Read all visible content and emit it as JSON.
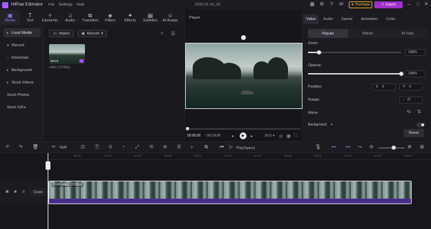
{
  "app": {
    "name": "HitPaw Edimakor",
    "menus": [
      "File",
      "Settings",
      "Help"
    ],
    "doc_title": "2025-01-15_02",
    "purchase": "Purchase",
    "export": "Export"
  },
  "tooltabs": [
    {
      "label": "Media",
      "icon": "media-icon"
    },
    {
      "label": "Text",
      "icon": "text-icon"
    },
    {
      "label": "Elements",
      "icon": "elements-icon"
    },
    {
      "label": "Audio",
      "icon": "audio-icon"
    },
    {
      "label": "Transition",
      "icon": "transition-icon"
    },
    {
      "label": "Filters",
      "icon": "filters-icon"
    },
    {
      "label": "Effects",
      "icon": "effects-icon"
    },
    {
      "label": "Subtitles",
      "icon": "subtitles-icon"
    },
    {
      "label": "AI Avatar",
      "icon": "ai-avatar-icon"
    }
  ],
  "sidebar": [
    "Local Media",
    "Record",
    "Download",
    "Background",
    "Stock Videos",
    "Stock Photos",
    "Stock GIFs"
  ],
  "media": {
    "import": "Import",
    "record": "Record",
    "thumb_duration": "00:24",
    "thumb_name": "video (2160p)"
  },
  "player": {
    "title": "Player",
    "current": "00:00:00",
    "total": "/ 00:24:06",
    "aspect": "16:9"
  },
  "props": {
    "tabs": [
      "Video",
      "Audio",
      "Speed",
      "Animation",
      "Color"
    ],
    "subtabs": [
      "Popular",
      "Effects",
      "AI Tools"
    ],
    "zoom_label": "Zoom",
    "zoom_value": "100%",
    "zoom_level": 0.12,
    "opacity_label": "Opacity",
    "opacity_value": "100%",
    "opacity_level": 1.0,
    "position_label": "Position",
    "pos_x_label": "X",
    "pos_x": "0",
    "pos_y_label": "Y",
    "pos_y": "0",
    "rotate_label": "Rotate",
    "rotate_value": "0°",
    "mirror_label": "Mirror",
    "background_label": "Background",
    "reset": "Reset"
  },
  "timeline": {
    "split": "Split",
    "play_space": "Play(Space)",
    "ticks": [
      "00:02",
      "00:04",
      "00:06",
      "00:08",
      "00:10",
      "00:12",
      "00:14",
      "00:16",
      "00:18",
      "00:20",
      "00:22",
      "00:24"
    ],
    "cover": "Cover",
    "clip_label": "0:24 video (2160p)"
  }
}
